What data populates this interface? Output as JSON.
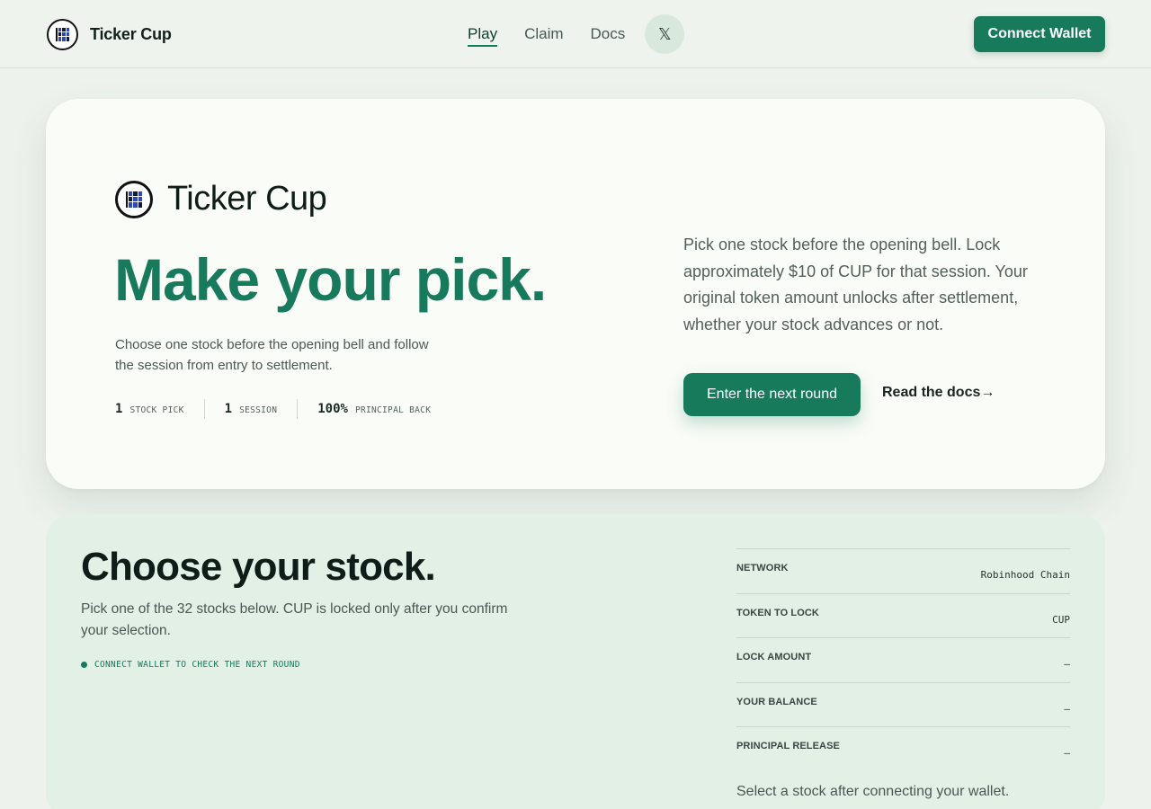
{
  "header": {
    "brand": "Ticker Cup",
    "nav": [
      {
        "label": "Play",
        "active": true
      },
      {
        "label": "Claim",
        "active": false
      },
      {
        "label": "Docs",
        "active": false
      }
    ],
    "x_icon_glyph": "𝕏",
    "connect_label": "Connect Wallet"
  },
  "hero": {
    "brand": "Ticker Cup",
    "title": "Make your pick.",
    "subtitle": "Choose one stock before the opening bell and follow the session from entry to settlement.",
    "stats": [
      {
        "value": "1",
        "label": "STOCK PICK"
      },
      {
        "value": "1",
        "label": "SESSION"
      },
      {
        "value": "100%",
        "label": "PRINCIPAL BACK"
      }
    ],
    "description": "Pick one stock before the opening bell. Lock approximately $10 of CUP for that session. Your original token amount unlocks after settlement, whether your stock advances or not.",
    "enter_label": "Enter the next round",
    "docs_label": "Read the docs→"
  },
  "choose": {
    "title": "Choose your stock.",
    "subtitle": "Pick one of the 32 stocks below. CUP is locked only after you confirm your selection.",
    "status": "CONNECT WALLET TO CHECK THE NEXT ROUND",
    "info": [
      {
        "key": "NETWORK",
        "value": "Robinhood Chain"
      },
      {
        "key": "TOKEN TO LOCK",
        "value": "CUP"
      },
      {
        "key": "LOCK AMOUNT",
        "value": "—"
      },
      {
        "key": "YOUR BALANCE",
        "value": "—"
      },
      {
        "key": "PRINCIPAL RELEASE",
        "value": "—"
      }
    ],
    "note": "Select a stock after connecting your wallet."
  },
  "colors": {
    "accent": "#177a5b",
    "background": "#edf2ec",
    "card": "#fafcf7",
    "section": "#e3f0e6",
    "logo_blue": "#2f48b8"
  }
}
